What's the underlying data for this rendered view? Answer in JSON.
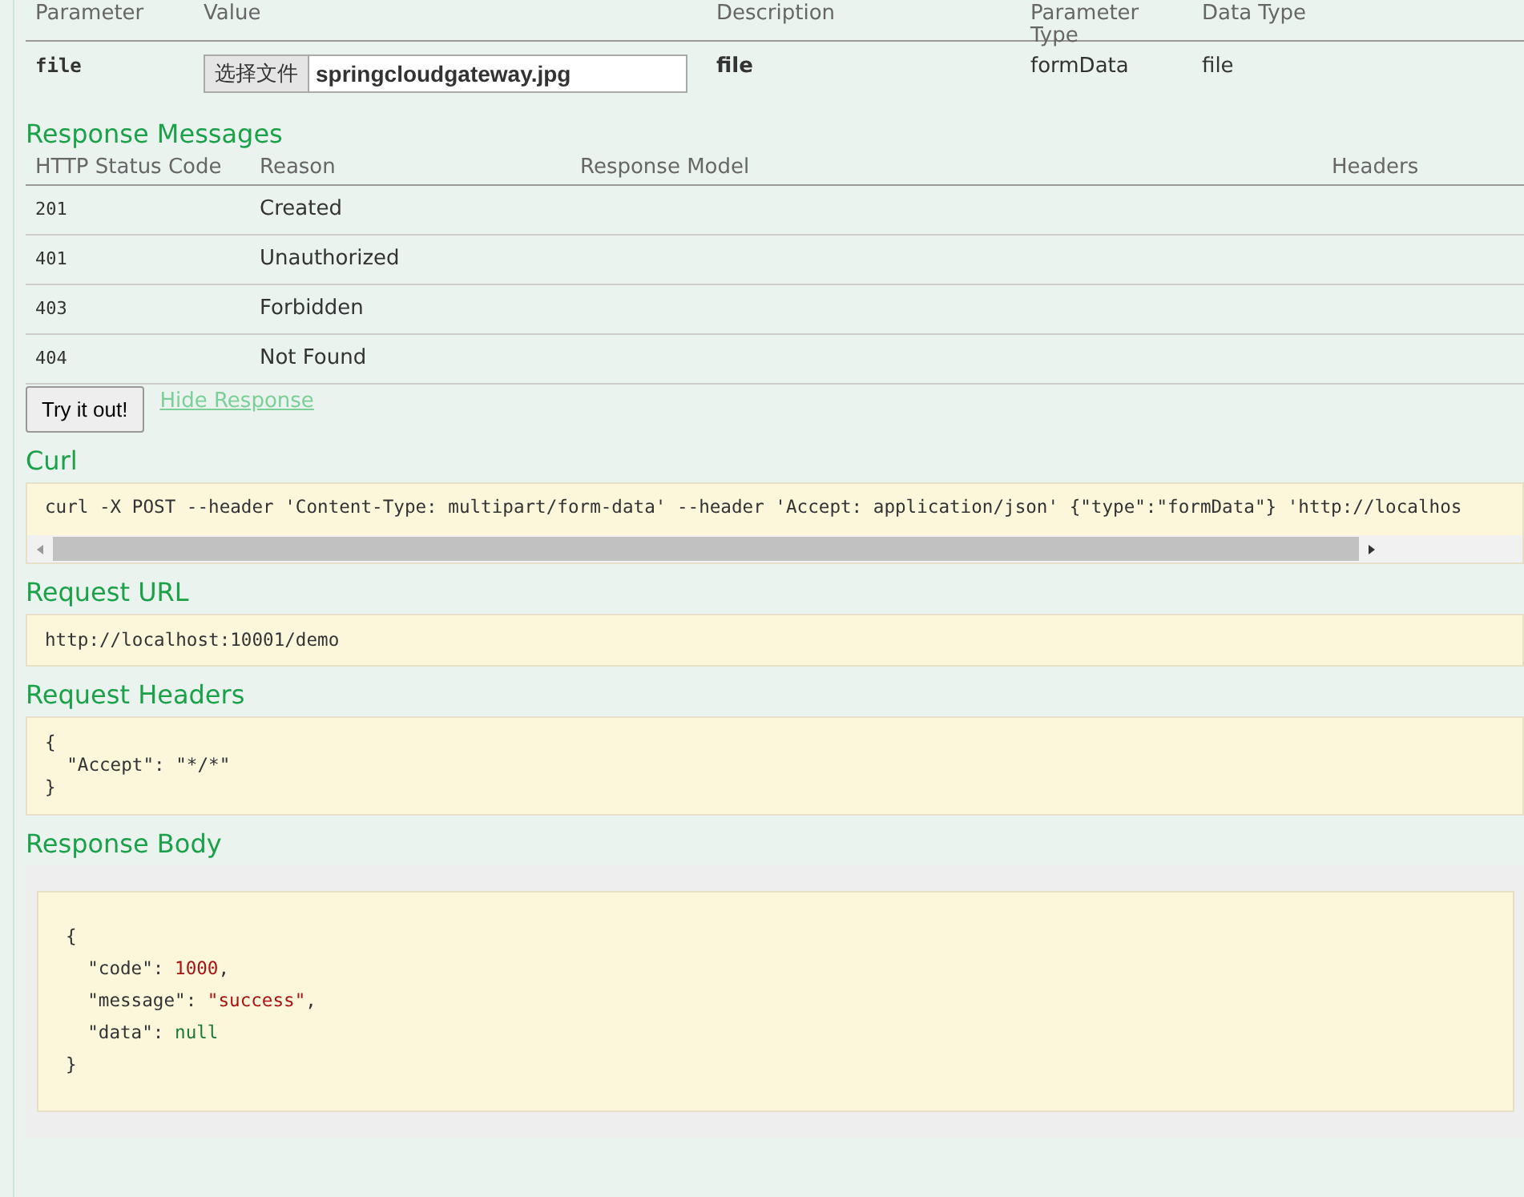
{
  "parameters_table": {
    "columns": [
      "Parameter",
      "Value",
      "Description",
      "Parameter Type",
      "Data Type"
    ],
    "rows": [
      {
        "parameter": "file",
        "file_button": "选择文件",
        "file_name": "springcloudgateway.jpg",
        "description": "file",
        "parameter_type": "formData",
        "data_type": "file"
      }
    ]
  },
  "response_messages": {
    "title": "Response Messages",
    "columns": [
      "HTTP Status Code",
      "Reason",
      "Response Model",
      "Headers"
    ],
    "rows": [
      {
        "code": "201",
        "reason": "Created"
      },
      {
        "code": "401",
        "reason": "Unauthorized"
      },
      {
        "code": "403",
        "reason": "Forbidden"
      },
      {
        "code": "404",
        "reason": "Not Found"
      }
    ]
  },
  "try_button": "Try it out!",
  "hide_link": "Hide Response",
  "curl": {
    "title": "Curl",
    "command": "curl -X POST --header 'Content-Type: multipart/form-data' --header 'Accept: application/json' {\"type\":\"formData\"} 'http://localhos"
  },
  "request_url": {
    "title": "Request URL",
    "value": "http://localhost:10001/demo"
  },
  "request_headers": {
    "title": "Request Headers",
    "lines": [
      "{",
      "  \"Accept\": \"*/*\"",
      "}"
    ]
  },
  "response_body": {
    "title": "Response Body",
    "lines": [
      [
        {
          "kind": "punct",
          "text": "{"
        }
      ],
      [
        {
          "kind": "key",
          "text": "  \"code\": "
        },
        {
          "kind": "number",
          "text": "1000"
        },
        {
          "kind": "punct",
          "text": ","
        }
      ],
      [
        {
          "kind": "key",
          "text": "  \"message\": "
        },
        {
          "kind": "string",
          "text": "\"success\""
        },
        {
          "kind": "punct",
          "text": ","
        }
      ],
      [
        {
          "kind": "key",
          "text": "  \"data\": "
        },
        {
          "kind": "literal",
          "text": "null"
        }
      ],
      [
        {
          "kind": "punct",
          "text": "}"
        }
      ]
    ]
  }
}
